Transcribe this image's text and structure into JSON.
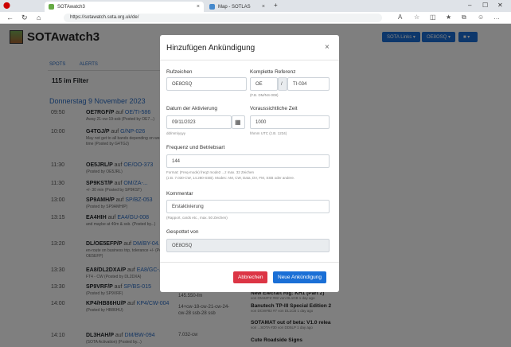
{
  "browser": {
    "tabs": [
      {
        "label": "SOTAwatch3"
      },
      {
        "label": "Map - SOTLAS"
      }
    ],
    "new_tab": "+",
    "url": "https://sotawatch.sota.org.uk/de/",
    "win": {
      "min": "–",
      "max": "☐",
      "close": "✕"
    }
  },
  "header": {
    "logo": "SOTAwatch3",
    "links_btn": "SOTA Links ▾",
    "user_btn": "OE8OSQ ▾",
    "lang_btn": "▾"
  },
  "tabs": {
    "spots": "SPOTS",
    "alerts": "ALERTS"
  },
  "filter": "115 im Filter",
  "date_heading": "Donnerstag 9 November 2023",
  "spots": [
    {
      "time": "09:50",
      "call": "OE7RGF/P",
      "on": "auf",
      "ref": "OE/TI-586",
      "comment": "Away 21-cw-19-ssb (Posted by OE7...)"
    },
    {
      "time": "10:00",
      "call": "G4TGJ/P",
      "on": "auf",
      "ref": "G/NP-026",
      "comment": "May not get to all bands depending on weather and my time (Posted by G4TGJ)"
    },
    {
      "time": "11:30",
      "call": "OE5JRL/P",
      "on": "auf",
      "ref": "OE/OO-373",
      "comment": "(Posted by OE5JRL)"
    },
    {
      "time": "11:30",
      "call": "SP9KST/P",
      "on": "auf",
      "ref": "OM/ZA-...",
      "comment": "+/- 30 min (Posted by SP9KST)"
    },
    {
      "time": "13:00",
      "call": "SP9AMH/P",
      "on": "auf",
      "ref": "SP/BZ-053",
      "comment": "(Posted by SP9AMH/P)"
    },
    {
      "time": "13:15",
      "call": "EA4HIH",
      "on": "auf",
      "ref": "EA4/GU-008",
      "comment": "and maybe at 40m & ssb. (Posted by...)"
    },
    {
      "time": "13:20",
      "call": "DL/OE5EFP/P",
      "on": "auf",
      "ref": "DM/BY-04...",
      "comment": "en-route on business trip, tolerance +/- (Posted by OE5EFP)"
    },
    {
      "time": "13:30",
      "call": "EA8/DL2DXA/P",
      "on": "auf",
      "ref": "EA8/GC-...",
      "comment": "FT4 - CW (Posted by DL2DXA)"
    },
    {
      "time": "13:30",
      "call": "SP9VRF/P",
      "on": "auf",
      "ref": "SP/BS-015",
      "comment": "(Posted by SP9VRF)"
    },
    {
      "time": "14:00",
      "call": "KP4/HB86HU/P",
      "on": "auf",
      "ref": "KP4/CW-004",
      "comment": "(Posted by HB86HU)"
    },
    {
      "time": "14:10",
      "call": "DL3HAH/P",
      "on": "auf",
      "ref": "DM/BW-094",
      "comment": "(SOTA Activation) (Posted by...)"
    }
  ],
  "freqs": [
    "145.550-fm",
    "14+cw-18-cw-21-cw-24-cw-28 ssb-28 ssb",
    "7.032-cw"
  ],
  "news": [
    {
      "title": "New Elecraft Rig: KH1 (Part 2)",
      "sub": "von GM4ZFZ #82 von DL1CB 1 day ago"
    },
    {
      "title": "Banutech TP-III Special Edition 2",
      "sub": "von DCW#82 #7 von DL1CB 1 day ago"
    },
    {
      "title": "SOTAMAT out of beta: V1.0 relea",
      "sub": "von ...SOTA #30 von DD5LP 1 day ago"
    },
    {
      "title": "Cute Roadside Signs",
      "sub": ""
    }
  ],
  "modal": {
    "title": "Hinzufügen Ankündigung",
    "close": "×",
    "callsign_label": "Rufzeichen",
    "callsign_value": "OE8OSQ",
    "ref_label": "Komplette Referenz",
    "ref_assoc": "OE",
    "ref_sep": "/",
    "ref_summit": "TI-034",
    "ref_help": "(F.B. DM/NS-008)",
    "date_label": "Datum der Aktivierung",
    "date_value": "09/11/2023",
    "date_help": "dd/mm/yyyy",
    "time_label": "Voraussichtliche Zeit",
    "time_value": "1000",
    "time_help": "hhmm UTC (z.B. 1234)",
    "freq_label": "Frequenz und Betriebsart",
    "freq_value": "144",
    "freq_help1": "Format: (Freq-mode) freq2 mode2 ...z max. 32 Zeichen",
    "freq_help2": "(z.B. 7.030-CW, 14.280-SSB). Modes: AM, CW, Data, DV, FM, SSB oder andere.",
    "comment_label": "Kommentar",
    "comment_value": "Erstaktivierung",
    "comment_help": "(Rapport, cards etc., max. 50 Zeichen)",
    "posted_label": "Gespottet von",
    "posted_value": "OE8OSQ",
    "cancel": "Abbrechen",
    "submit": "Neue Ankündigung"
  },
  "colors": {
    "primary": "#1a6fd6",
    "danger": "#dc3545",
    "link": "#2a6cc4"
  }
}
